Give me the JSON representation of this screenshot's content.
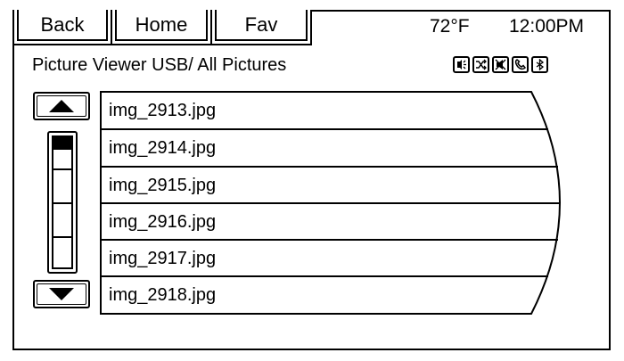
{
  "nav": {
    "back_label": "Back",
    "home_label": "Home",
    "fav_label": "Fav"
  },
  "status": {
    "temperature": "72°F",
    "time": "12:00PM"
  },
  "header": {
    "title": "Picture Viewer USB/ All Pictures",
    "status_icons": [
      "voice-command-icon",
      "shuffle-icon",
      "mute-icon",
      "phone-icon",
      "bluetooth-icon"
    ]
  },
  "list": {
    "items": [
      {
        "label": "img_2913.jpg"
      },
      {
        "label": "img_2914.jpg"
      },
      {
        "label": "img_2915.jpg"
      },
      {
        "label": "img_2916.jpg"
      },
      {
        "label": "img_2917.jpg"
      },
      {
        "label": "img_2918.jpg"
      }
    ],
    "scroll_segments": 4
  }
}
